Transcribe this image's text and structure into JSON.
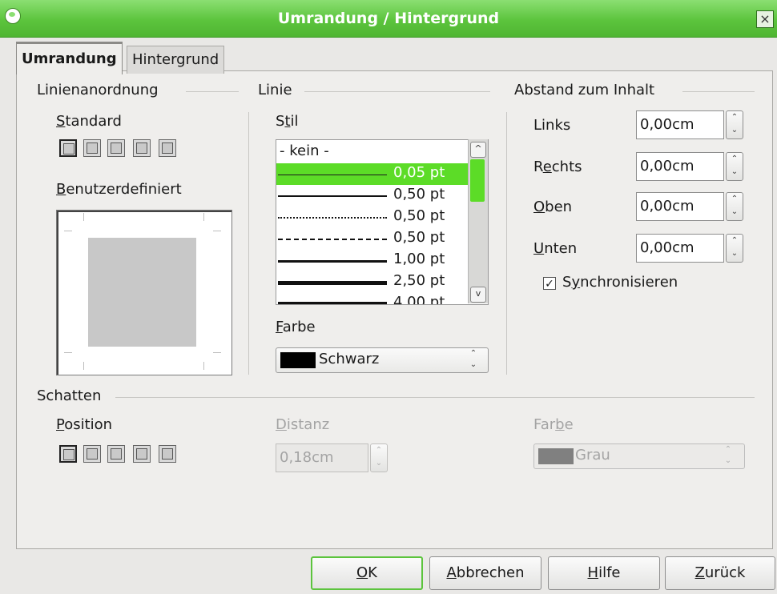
{
  "window": {
    "title": "Umrandung / Hintergrund"
  },
  "tabs": [
    {
      "label": "Umrandung",
      "active": true
    },
    {
      "label": "Hintergrund",
      "active": false
    }
  ],
  "line_arrangement": {
    "title": "Linienanordnung",
    "standard_label_u": "S",
    "standard_label_rest": "tandard",
    "custom_label_u": "B",
    "custom_label_rest": "enutzerdefiniert"
  },
  "line": {
    "title": "Linie",
    "style_label_a": "S",
    "style_label_u": "t",
    "style_label_b": "il",
    "styles": [
      {
        "label": "- kein -",
        "kind": "none"
      },
      {
        "label": "0,05 pt",
        "kind": "solid",
        "width": 1,
        "selected": true
      },
      {
        "label": "0,50 pt",
        "kind": "solid",
        "width": 2
      },
      {
        "label": "0,50 pt",
        "kind": "dotted",
        "width": 2
      },
      {
        "label": "0,50 pt",
        "kind": "dashed",
        "width": 2
      },
      {
        "label": "1,00 pt",
        "kind": "solid",
        "width": 3
      },
      {
        "label": "2,50 pt",
        "kind": "solid",
        "width": 5
      },
      {
        "label": "4,00 pt",
        "kind": "solid",
        "width": 7
      }
    ],
    "color_label_u": "F",
    "color_label_rest": "arbe",
    "color_value": "Schwarz",
    "color_hex": "#000000"
  },
  "spacing": {
    "title": "Abstand zum Inhalt",
    "left_label": "Links",
    "left_value": "0,00cm",
    "right_label_a": "R",
    "right_label_u": "e",
    "right_label_b": "chts",
    "right_value": "0,00cm",
    "top_label_u": "O",
    "top_label_rest": "ben",
    "top_value": "0,00cm",
    "bottom_label_u": "U",
    "bottom_label_rest": "nten",
    "bottom_value": "0,00cm",
    "sync_label_u": "y",
    "sync_label_a": "S",
    "sync_label_b": "nchronisieren",
    "sync_checked": true
  },
  "shadow": {
    "title": "Schatten",
    "position_label_u": "P",
    "position_label_rest": "osition",
    "distance_label_u": "D",
    "distance_label_rest": "istanz",
    "distance_value": "0,18cm",
    "color_label_a": "Far",
    "color_label_u": "b",
    "color_label_b": "e",
    "color_value": "Grau",
    "color_hex": "#808080"
  },
  "buttons": {
    "ok_u": "O",
    "ok_rest": "K",
    "cancel_u": "A",
    "cancel_rest": "bbrechen",
    "help_u": "H",
    "help_rest": "ilfe",
    "reset_u": "Z",
    "reset_rest": "urück"
  },
  "colors": {
    "accent": "#5cc43d",
    "selection": "#5cdc27"
  }
}
